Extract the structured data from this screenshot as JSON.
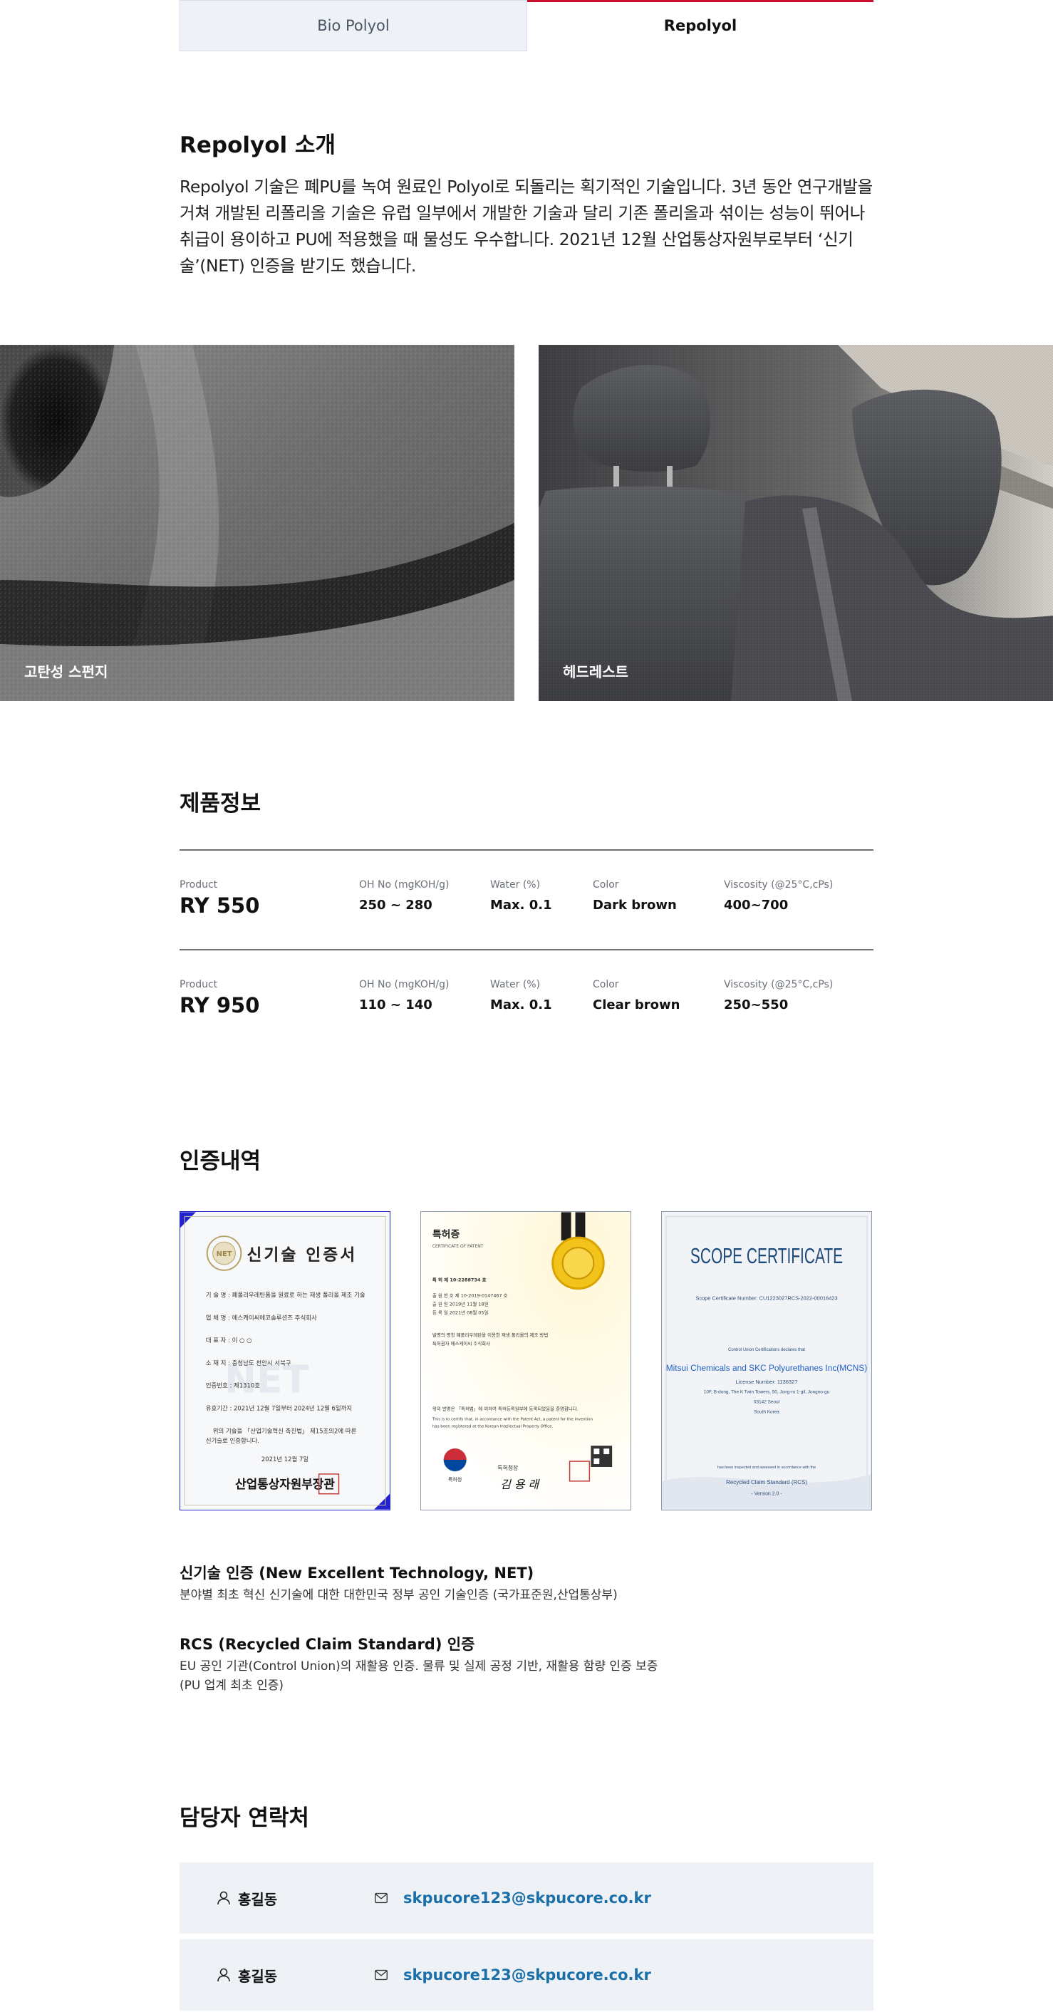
{
  "tabs": [
    {
      "label": "Bio Polyol",
      "active": false
    },
    {
      "label": "Repolyol",
      "active": true
    }
  ],
  "intro": {
    "title": "Repolyol 소개",
    "text": "Repolyol 기술은 폐PU를 녹여 원료인 Polyol로 되돌리는 획기적인 기술입니다. 3년 동안 연구개발을 거쳐 개발된 리폴리올 기술은 유럽 일부에서 개발한 기술과 달리 기존 폴리올과 섞이는 성능이 뛰어나 취급이 용이하고 PU에 적용했을 때 물성도 우수합니다.  2021년 12월 산업통상자원부로부터 ‘신기술’(NET) 인증을 받기도 했습니다."
  },
  "photos": [
    {
      "caption": "고탄성 스펀지",
      "icon": "foam-photo"
    },
    {
      "caption": "헤드레스트",
      "icon": "car-seat-photo"
    }
  ],
  "product_info": {
    "title": "제품정보",
    "labels": {
      "product": "Product",
      "oh": "OH No (mgKOH/g)",
      "water": "Water (%)",
      "color": "Color",
      "viscosity": "Viscosity (@25°C,cPs)"
    },
    "rows": [
      {
        "product": "RY 550",
        "oh": "250 ~ 280",
        "water": "Max. 0.1",
        "color": "Dark brown",
        "viscosity": "400~700"
      },
      {
        "product": "RY 950",
        "oh": "110 ~ 140",
        "water": "Max. 0.1",
        "color": "Clear brown",
        "viscosity": "250~550"
      }
    ]
  },
  "certifications": {
    "title": "인증내역",
    "documents": [
      {
        "heading": "신기술 인증서",
        "lines": [
          "기 술 명 : 폐폴리우레탄폼을 원료로 하는 재생 폴리올 제조 기술",
          "업 체 명 : 에스케이씨에코솔루션즈 주식회사",
          "대 표 자 : 이 ○ ○",
          "소 재 지 : 충청남도 천안시 서북구",
          "인증번호 : 제1310호",
          "유효기간 : 2021년 12월 7일부터 2024년 12월 6일까지",
          "위의 기술을 「산업기술혁신 촉진법」 제15조의2에 따른",
          "신기술로 인증합니다.",
          "2021년 12월 7일"
        ],
        "issuer": "산업통상자원부장관",
        "logo_text": "NET"
      },
      {
        "heading": "특허증",
        "subheading": "CERTIFICATE OF PATENT",
        "lines": [
          "특 허   제 10-2288734 호",
          "출 원 번 호   제 10-2019-0147467 호",
          "출 원 일   2019년 11월 18일",
          "등 록 일   2021년 08월 05일",
          "발명의 명칭   폐폴리우레탄을 이용한 재생 폴리올의 제조 방법",
          "특허권자   에스케이씨 주식회사",
          "위의 발명은 「특허법」에 의하여 특허등록원부에 등록되었음을 증명합니다.",
          "This is to certify that, in accordance with the Patent Act, a patent for the invention",
          "has been registered at the Korean Intellectual Property Office."
        ],
        "issuer": "특허청장",
        "signature": "김 용 래",
        "logo_label": "특허청"
      },
      {
        "heading": "SCOPE CERTIFICATE",
        "lines": [
          "Scope Certificate Number: CU1223027RCS-2022-00016423",
          "Control Union Certifications declares that",
          "Mitsui Chemicals and SKC Polyurethanes Inc(MCNS)",
          "License Number: 1136327",
          "10F, B-dong, The K Twin Towers, 50, Jong-ro 1-gil, Jongno-gu",
          "03142 Seoul",
          "South Korea",
          "has been inspected and assessed in accordance with the",
          "Recycled Claim Standard (RCS)",
          "- Version 2.0 -"
        ]
      }
    ],
    "descriptions": [
      {
        "title": "신기술 인증  (New Excellent Technology, NET)",
        "lines": [
          "분야별 최초 혁신 신기술에 대한 대한민국 정부 공인 기술인증 (국가표준원,산업통상부)"
        ]
      },
      {
        "title": "RCS (Recycled Claim Standard) 인증",
        "lines": [
          "EU 공인 기관(Control Union)의 재활용 인증. 물류 및 실제 공정 기반, 재활용 함량 인증 보증",
          "(PU 업계 최초 인증)"
        ]
      }
    ]
  },
  "contacts": {
    "title": "담당자 연락처",
    "items": [
      {
        "name": "홍길동",
        "email": "skpucore123@skpucore.co.kr"
      },
      {
        "name": "홍길동",
        "email": "skpucore123@skpucore.co.kr"
      }
    ]
  },
  "colors": {
    "accent_red": "#c8102e",
    "tab_bg": "#eef2f7",
    "link_blue": "#1a6fa8",
    "cert_blue": "#2222cc"
  }
}
